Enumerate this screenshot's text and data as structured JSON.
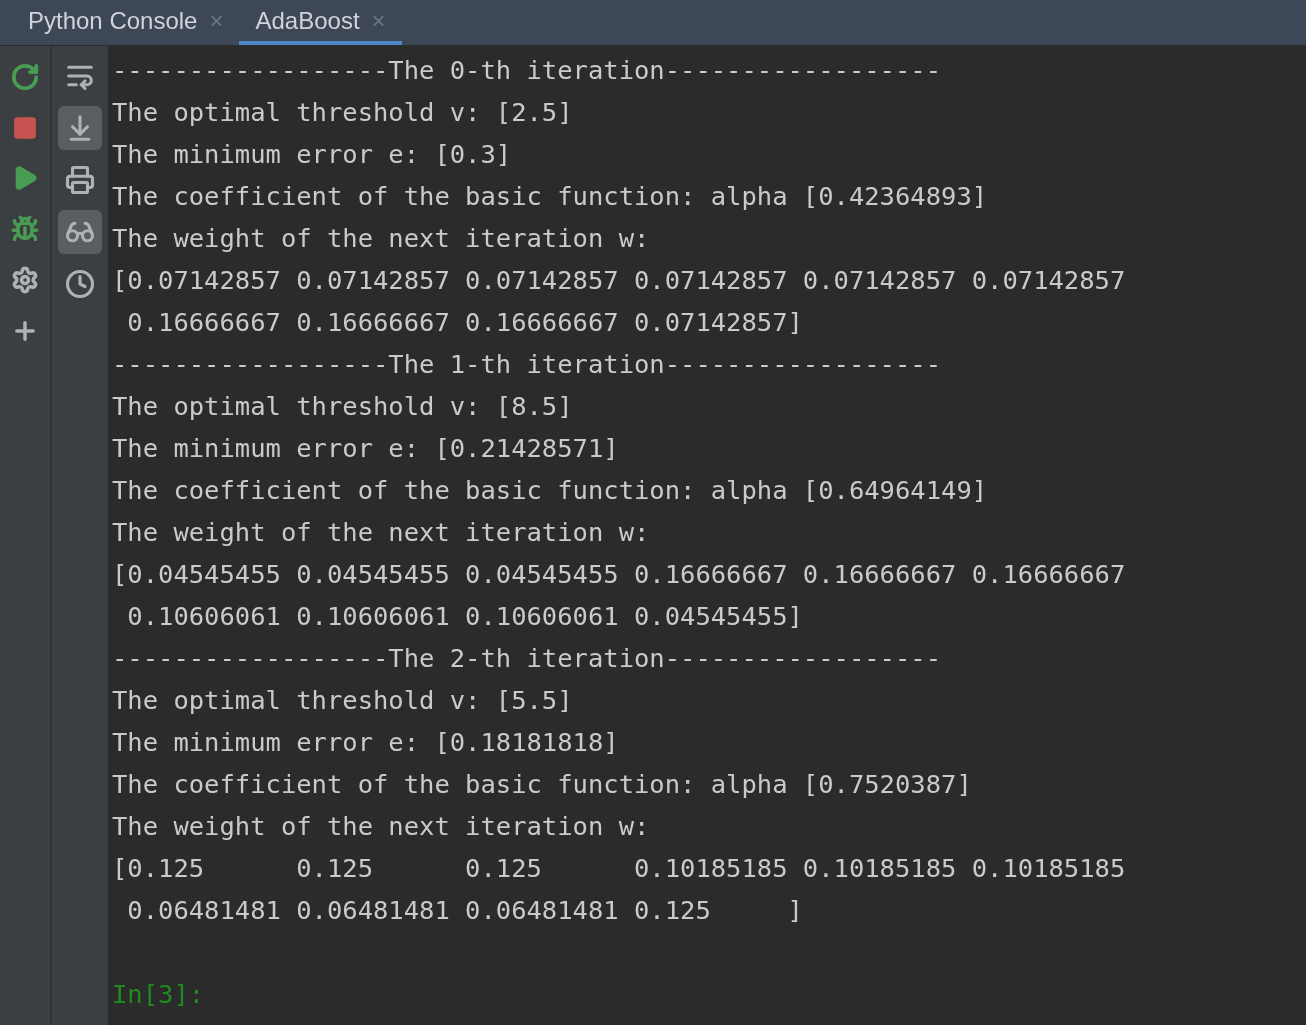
{
  "tabs": [
    {
      "label": "Python Console",
      "close": "×",
      "selected": false
    },
    {
      "label": "AdaBoost",
      "close": "×",
      "selected": true
    }
  ],
  "console_toolbar": [
    {
      "kind": "wrap",
      "on": false
    },
    {
      "kind": "scroll-end",
      "on": true
    },
    {
      "kind": "print",
      "on": false
    },
    {
      "kind": "variables",
      "on": true
    },
    {
      "kind": "history",
      "on": false
    }
  ],
  "output_lines": [
    "------------------The 0-th iteration------------------",
    "The optimal threshold v: [2.5]",
    "The minimum error e: [0.3]",
    "The coefficient of the basic function: alpha [0.42364893]",
    "The weight of the next iteration w:",
    "[0.07142857 0.07142857 0.07142857 0.07142857 0.07142857 0.07142857",
    " 0.16666667 0.16666667 0.16666667 0.07142857]",
    "------------------The 1-th iteration------------------",
    "The optimal threshold v: [8.5]",
    "The minimum error e: [0.21428571]",
    "The coefficient of the basic function: alpha [0.64964149]",
    "The weight of the next iteration w:",
    "[0.04545455 0.04545455 0.04545455 0.16666667 0.16666667 0.16666667",
    " 0.10606061 0.10606061 0.10606061 0.04545455]",
    "------------------The 2-th iteration------------------",
    "The optimal threshold v: [5.5]",
    "The minimum error e: [0.18181818]",
    "The coefficient of the basic function: alpha [0.7520387]",
    "The weight of the next iteration w:",
    "[0.125      0.125      0.125      0.10185185 0.10185185 0.10185185",
    " 0.06481481 0.06481481 0.06481481 0.125     ]"
  ],
  "prompt": "In[3]:"
}
